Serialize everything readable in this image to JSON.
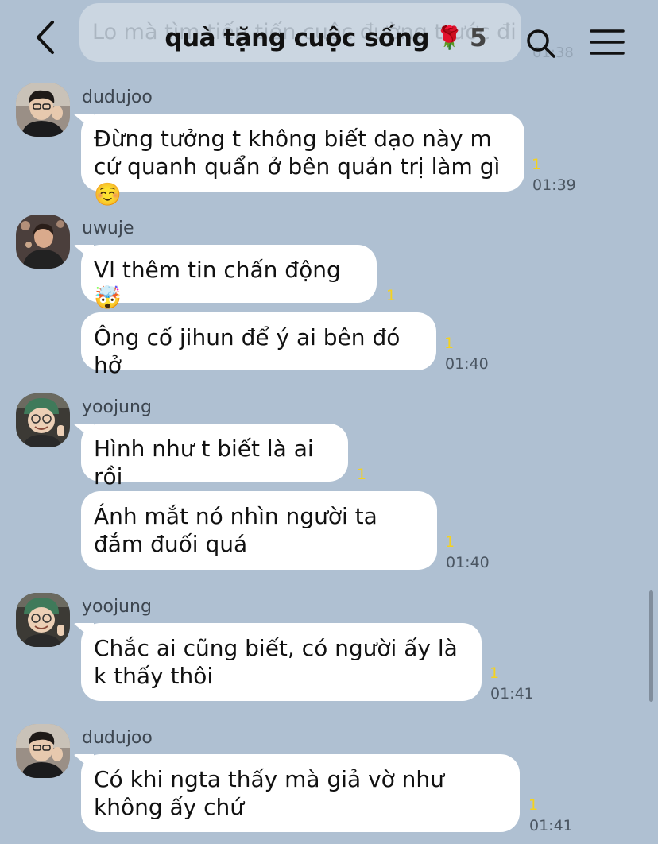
{
  "header": {
    "ghost_message": "Lo mà tìm tiếp tiến cuộc đường trước đi",
    "ghost_time": "01:38",
    "title": "quà tặng cuộc sống",
    "title_emoji": "🌹",
    "member_count": "5",
    "icons": {
      "back": "chevron-left-icon",
      "search": "search-icon",
      "menu": "hamburger-menu-icon"
    }
  },
  "messages": [
    {
      "sender": "dudujoo",
      "text": "Đừng tưởng t không biết dạo này m cứ quanh quẩn ở bên quản trị làm gì☺️",
      "read": "1",
      "time": "01:39"
    },
    {
      "sender": "uwuje",
      "text": "Vl thêm tin chấn động🤯",
      "read": "1",
      "time": ""
    },
    {
      "sender": "",
      "text": "Ông cố jihun để ý ai bên đó hở",
      "read": "1",
      "time": "01:40"
    },
    {
      "sender": "yoojung",
      "text": "Hình như t biết là ai rồi",
      "read": "1",
      "time": ""
    },
    {
      "sender": "",
      "text": "Ánh mắt nó nhìn người ta đắm đuối quá",
      "read": "1",
      "time": "01:40"
    },
    {
      "sender": "yoojung",
      "text": "Chắc ai cũng biết, có người ấy là k thấy thôi",
      "read": "1",
      "time": "01:41"
    },
    {
      "sender": "dudujoo",
      "text": "Có khi ngta thấy mà giả vờ như không ấy chứ",
      "read": "1",
      "time": "01:41"
    }
  ]
}
